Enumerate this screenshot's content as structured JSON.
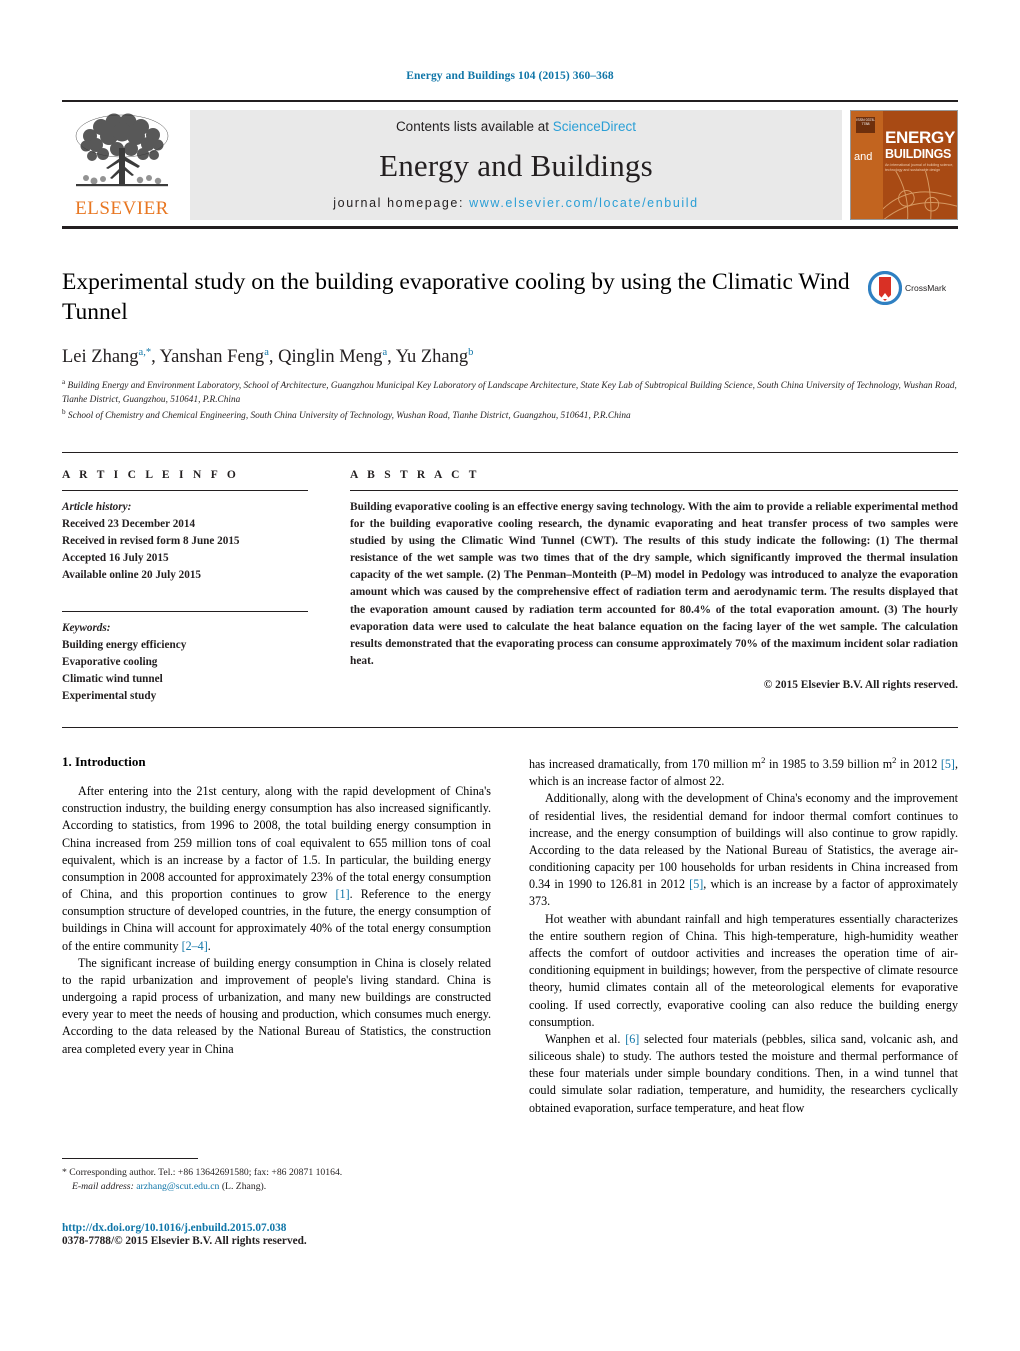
{
  "running_head": "Energy and Buildings 104 (2015) 360–368",
  "masthead": {
    "publisher_name": "ELSEVIER",
    "contents_prefix": "Contents lists available at ",
    "sciencedirect": "ScienceDirect",
    "journal_name": "Energy and Buildings",
    "homepage_prefix": "journal homepage: ",
    "homepage_url": "www.elsevier.com/locate/enbuild",
    "cover": {
      "badge_text": "ISSN 0378-7788",
      "and_word": "and",
      "energy_word": "ENERGY",
      "buildings_word": "BUILDINGS",
      "subtitle": "An international journal of building science, technology and sustainable design"
    }
  },
  "article": {
    "title": "Experimental study on the building evaporative cooling by using the Climatic Wind Tunnel",
    "crossmark_label": "CrossMark",
    "authors": [
      {
        "name": "Lei Zhang",
        "sup": "a,*"
      },
      {
        "name": "Yanshan Feng",
        "sup": "a"
      },
      {
        "name": "Qinglin Meng",
        "sup": "a"
      },
      {
        "name": "Yu Zhang",
        "sup": "b"
      }
    ],
    "affiliations": [
      {
        "marker": "a",
        "text": "Building Energy and Environment Laboratory, School of Architecture, Guangzhou Municipal Key Laboratory of Landscape Architecture, State Key Lab of Subtropical Building Science, South China University of Technology, Wushan Road, Tianhe District, Guangzhou, 510641, P.R.China"
      },
      {
        "marker": "b",
        "text": "School of Chemistry and Chemical Engineering, South China University of Technology, Wushan Road, Tianhe District, Guangzhou, 510641, P.R.China"
      }
    ]
  },
  "article_info": {
    "heading": "A R T I C L E   I N F O",
    "history_label": "Article history:",
    "history": [
      "Received 23 December 2014",
      "Received in revised form 8 June 2015",
      "Accepted 16 July 2015",
      "Available online 20 July 2015"
    ],
    "keywords_label": "Keywords:",
    "keywords": [
      "Building energy efficiency",
      "Evaporative cooling",
      "Climatic wind tunnel",
      "Experimental study"
    ]
  },
  "abstract": {
    "heading": "A B S T R A C T",
    "text": "Building evaporative cooling is an effective energy saving technology. With the aim to provide a reliable experimental method for the building evaporative cooling research, the dynamic evaporating and heat transfer process of two samples were studied by using the Climatic Wind Tunnel (CWT). The results of this study indicate the following: (1) The thermal resistance of the wet sample was two times that of the dry sample, which significantly improved the thermal insulation capacity of the wet sample. (2) The Penman–Monteith (P–M) model in Pedology was introduced to analyze the evaporation amount which was caused by the comprehensive effect of radiation term and aerodynamic term. The results displayed that the evaporation amount caused by radiation term accounted for 80.4% of the total evaporation amount. (3) The hourly evaporation data were used to calculate the heat balance equation on the facing layer of the wet sample. The calculation results demonstrated that the evaporating process can consume approximately 70% of the maximum incident solar radiation heat.",
    "copyright": "© 2015 Elsevier B.V. All rights reserved."
  },
  "body": {
    "section_heading": "1.  Introduction",
    "left_paragraphs": [
      "After entering into the 21st century, along with the rapid development of China's construction industry, the building energy consumption has also increased significantly. According to statistics, from 1996 to 2008, the total building energy consumption in China increased from 259 million tons of coal equivalent to 655 million tons of coal equivalent, which is an increase by a factor of 1.5. In particular, the building energy consumption in 2008 accounted for approximately 23% of the total energy consumption of China, and this proportion continues to grow [1]. Reference to the energy consumption structure of developed countries, in the future, the energy consumption of buildings in China will account for approximately 40% of the total energy consumption of the entire community [2–4].",
      "The significant increase of building energy consumption in China is closely related to the rapid urbanization and improvement of people's living standard. China is undergoing a rapid process of urbanization, and many new buildings are constructed every year to meet the needs of housing and production, which consumes much energy. According to the data released by the National Bureau of Statistics, the construction area completed every year in China"
    ],
    "right_paragraphs": [
      "has increased dramatically, from 170 million m2 in 1985 to 3.59 billion m2 in 2012 [5], which is an increase factor of almost 22.",
      "Additionally, along with the development of China's economy and the improvement of residential lives, the residential demand for indoor thermal comfort continues to increase, and the energy consumption of buildings will also continue to grow rapidly. According to the data released by the National Bureau of Statistics, the average air-conditioning capacity per 100 households for urban residents in China increased from 0.34 in 1990 to 126.81 in 2012 [5], which is an increase by a factor of approximately 373.",
      "Hot weather with abundant rainfall and high temperatures essentially characterizes the entire southern region of China. This high-temperature, high-humidity weather affects the comfort of outdoor activities and increases the operation time of air-conditioning equipment in buildings; however, from the perspective of climate resource theory, humid climates contain all of the meteorological elements for evaporative cooling. If used correctly, evaporative cooling can also reduce the building energy consumption.",
      "Wanphen et al. [6] selected four materials (pebbles, silica sand, volcanic ash, and siliceous shale) to study. The authors tested the moisture and thermal performance of these four materials under simple boundary conditions. Then, in a wind tunnel that could simulate solar radiation, temperature, and humidity, the researchers cyclically obtained evaporation, surface temperature, and heat flow"
    ],
    "citations": [
      "[1]",
      "[2–4]",
      "[5]",
      "[6]"
    ]
  },
  "footnotes": {
    "corresponding_marker": "*",
    "corresponding_text": "Corresponding author. Tel.: +86 13642691580; fax: +86 20871 10164.",
    "email_label": "E-mail address:",
    "email": "arzhang@scut.edu.cn",
    "email_owner": "(L. Zhang)."
  },
  "footer": {
    "doi": "http://dx.doi.org/10.1016/j.enbuild.2015.07.038",
    "issn_line": "0378-7788/© 2015 Elsevier B.V. All rights reserved."
  }
}
